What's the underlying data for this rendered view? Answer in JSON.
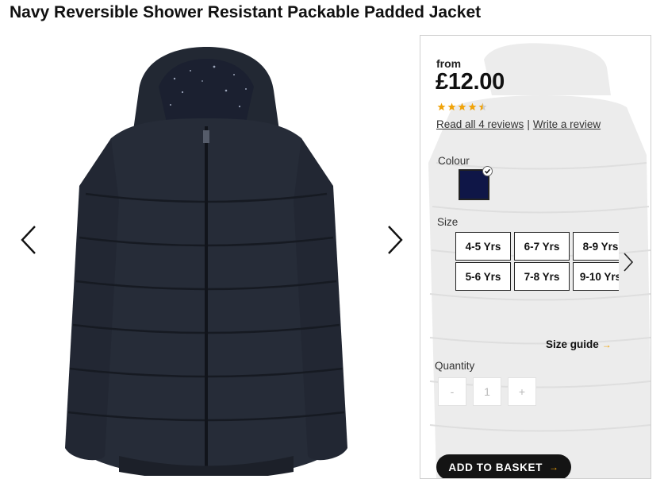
{
  "product": {
    "title": "Navy Reversible Shower Resistant Packable Padded Jacket"
  },
  "price": {
    "prefix": "from",
    "amount": "£12.00"
  },
  "rating": {
    "stars": 4.5,
    "max": 5,
    "read_reviews": "Read all 4 reviews",
    "separator": "|",
    "write_review": "Write a review"
  },
  "colour": {
    "label": "Colour",
    "selected_hex": "#0f1647"
  },
  "size": {
    "label": "Size",
    "options": [
      "4-5 Yrs",
      "6-7 Yrs",
      "8-9 Yrs",
      "5-6 Yrs",
      "7-8 Yrs",
      "9-10 Yrs"
    ],
    "guide": "Size guide",
    "guide_arrow": "→"
  },
  "quantity": {
    "label": "Quantity",
    "minus": "-",
    "value": "1",
    "plus": "+"
  },
  "basket": {
    "label": "ADD TO BASKET",
    "arrow": "→"
  },
  "icons": {
    "gallery_prev": "chevron-left-icon",
    "gallery_next": "chevron-right-icon",
    "sizes_next": "chevron-right-icon",
    "star": "star-icon",
    "check": "check-icon"
  },
  "colors": {
    "accent": "#f0a30a",
    "jacket": "#262c38",
    "button": "#141414"
  }
}
